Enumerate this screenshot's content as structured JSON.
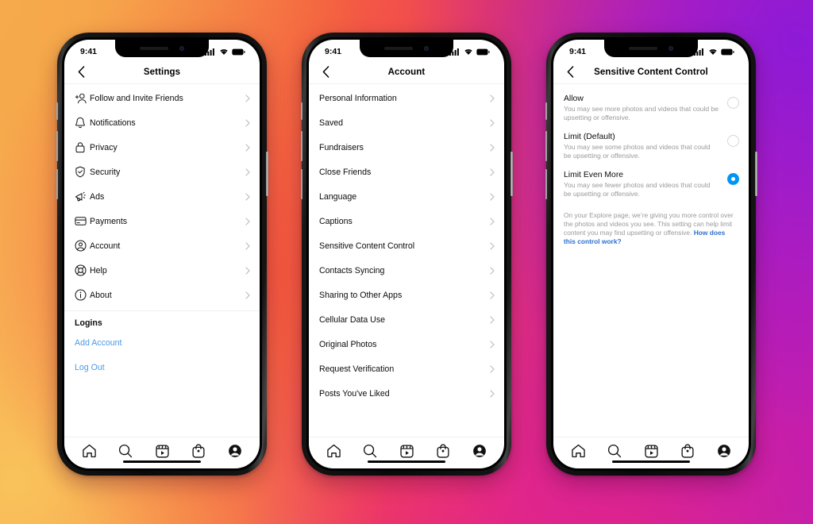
{
  "background": {
    "type": "instagram-gradient",
    "colors": [
      "#f7b155",
      "#f4613f",
      "#ef3a5c",
      "#d524a4",
      "#a31ad4"
    ]
  },
  "accent": {
    "blue": "#0095f6",
    "link": "#4a9ae8",
    "note_link": "#2c6fd1"
  },
  "status_bar": {
    "time": "9:41",
    "signal_icon": "cellular-signal-icon",
    "wifi_icon": "wifi-icon",
    "battery_icon": "battery-icon"
  },
  "tabbar": {
    "items": [
      {
        "icon": "home-icon",
        "name": "tab-home"
      },
      {
        "icon": "search-icon",
        "name": "tab-search"
      },
      {
        "icon": "reels-icon",
        "name": "tab-reels"
      },
      {
        "icon": "shop-bag-icon",
        "name": "tab-shop"
      },
      {
        "icon": "profile-icon",
        "name": "tab-profile"
      }
    ]
  },
  "phones": [
    {
      "id": "phone-settings",
      "title": "Settings",
      "back_icon": "chevron-left-icon",
      "rows": [
        {
          "icon": "add-person-icon",
          "label": "Follow and Invite Friends"
        },
        {
          "icon": "bell-icon",
          "label": "Notifications"
        },
        {
          "icon": "lock-icon",
          "label": "Privacy"
        },
        {
          "icon": "shield-check-icon",
          "label": "Security"
        },
        {
          "icon": "megaphone-icon",
          "label": "Ads"
        },
        {
          "icon": "credit-card-icon",
          "label": "Payments"
        },
        {
          "icon": "account-circle-icon",
          "label": "Account"
        },
        {
          "icon": "life-ring-icon",
          "label": "Help"
        },
        {
          "icon": "info-circle-icon",
          "label": "About"
        }
      ],
      "group_header": "Logins",
      "links": [
        "Add Account",
        "Log Out"
      ]
    },
    {
      "id": "phone-account",
      "title": "Account",
      "back_icon": "chevron-left-icon",
      "rows": [
        {
          "label": "Personal Information"
        },
        {
          "label": "Saved"
        },
        {
          "label": "Fundraisers"
        },
        {
          "label": "Close Friends"
        },
        {
          "label": "Language"
        },
        {
          "label": "Captions"
        },
        {
          "label": "Sensitive Content Control"
        },
        {
          "label": "Contacts Syncing"
        },
        {
          "label": "Sharing to Other Apps"
        },
        {
          "label": "Cellular Data Use"
        },
        {
          "label": "Original Photos"
        },
        {
          "label": "Request Verification"
        },
        {
          "label": "Posts You've Liked"
        }
      ]
    },
    {
      "id": "phone-sensitive-content",
      "title": "Sensitive Content Control",
      "back_icon": "chevron-left-icon",
      "options": [
        {
          "label": "Allow",
          "description": "You may see more photos and videos that could be upsetting or offensive.",
          "selected": false
        },
        {
          "label": "Limit (Default)",
          "description": "You may see some photos and videos that could be upsetting or offensive.",
          "selected": false
        },
        {
          "label": "Limit Even More",
          "description": "You may see fewer photos and videos that could be upsetting or offensive.",
          "selected": true
        }
      ],
      "note_text": "On your Explore page, we’re giving you more control over the photos and videos you see. This setting can help limit content you may find upsetting or offensive. ",
      "note_link": "How does this control work?"
    }
  ]
}
